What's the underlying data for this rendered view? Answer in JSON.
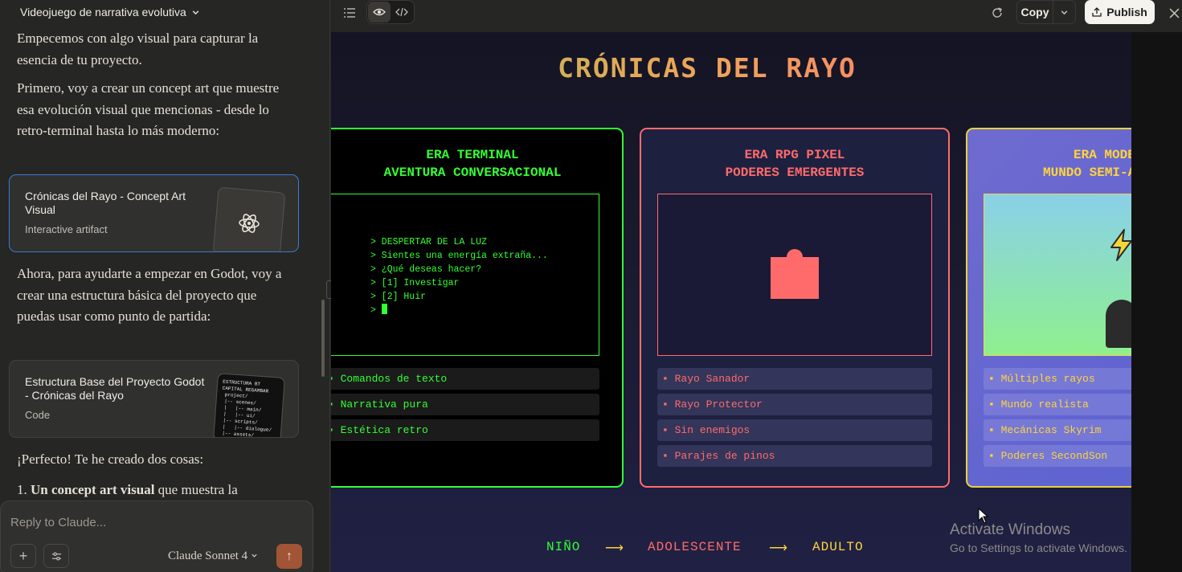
{
  "sidebar": {
    "project_title": "Videojuego de narrativa evolutiva",
    "messages": {
      "m1": "Empecemos con algo visual para capturar la esencia de tu proyecto.",
      "m2": "Primero, voy a crear un concept art que muestre esa evolución visual que mencionas - desde lo retro-terminal hasta lo más moderno:",
      "m3": "Ahora, para ayudarte a empezar en Godot, voy a crear una estructura básica del proyecto que puedas usar como punto de partida:",
      "m4": "¡Perfecto! Te he creado dos cosas:",
      "m5_bold": "Un concept art visual",
      "m5_rest": " que muestra la"
    },
    "artifact1": {
      "title": "Crónicas del Rayo - Concept Art Visual",
      "subtitle": "Interactive artifact"
    },
    "artifact2": {
      "title": "Estructura Base del Proyecto Godot - Crónicas del Rayo",
      "subtitle": "Code",
      "thumb_text": "ESTRUCTURA BT\nCAPITAL REGAMBAR\n project/\n |-- scenes/\n |   |-- main/\n |   |-- ui/\n |-- scripts/\n |   |-- dialogue/\n |-- assets/\n     |-- fonts/"
    },
    "reply_placeholder": "Reply to Claude...",
    "model_label": "Claude Sonnet 4"
  },
  "toolbar": {
    "copy_label": "Copy",
    "publish_label": "Publish"
  },
  "preview": {
    "title": "CRÓNICAS DEL RAYO",
    "eras": [
      {
        "line1": "ERA TERMINAL",
        "line2": "AVENTURA CONVERSACIONAL",
        "terminal_lines": [
          "> DESPERTAR DE LA LUZ",
          "> Sientes una energía extraña...",
          "> ¿Qué deseas hacer?",
          "> [1] Investigar",
          "> [2] Huir",
          "> "
        ],
        "features": [
          "▪ Comandos de texto",
          "▪ Narrativa pura",
          "▪ Estética retro"
        ]
      },
      {
        "line1": "ERA RPG PIXEL",
        "line2": "PODERES EMERGENTES",
        "features": [
          "▪ Rayo Sanador",
          "▪ Rayo Protector",
          "▪ Sin enemigos",
          "▪ Parajes de pinos"
        ]
      },
      {
        "line1": "ERA MODERNA",
        "line2": "MUNDO SEMI-ABIER",
        "features": [
          "▪ Múltiples rayos",
          "▪ Mundo realista",
          "▪ Mecánicas Skyrim",
          "▪ Poderes SecondSon"
        ]
      }
    ],
    "timeline": {
      "stage1": "NIÑO",
      "stage2": "ADOLESCENTE",
      "stage3": "ADULTO",
      "arrow": "⟶"
    }
  },
  "watermark": {
    "line1": "Activate Windows",
    "line2": "Go to Settings to activate Windows."
  },
  "colors": {
    "terminal": "#33ff33",
    "rpg": "#ff6b6b",
    "modern": "#ffd43b",
    "send": "#a25436",
    "selected_card": "#3a7bd5"
  }
}
